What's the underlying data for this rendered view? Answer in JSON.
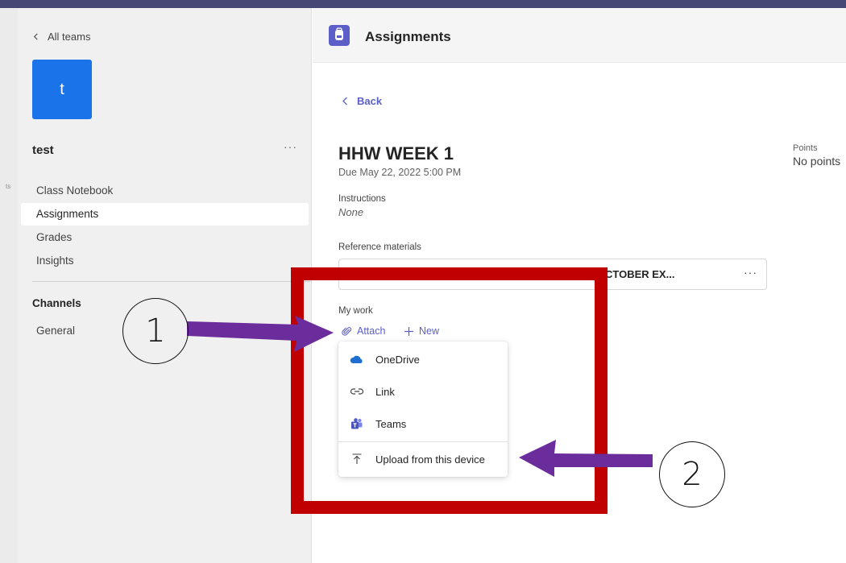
{
  "sidebar": {
    "all_teams": "All teams",
    "team_avatar_letter": "t",
    "team_name": "test",
    "more": "···",
    "nav": [
      "Class Notebook",
      "Assignments",
      "Grades",
      "Insights"
    ],
    "channels_title": "Channels",
    "channels": [
      "General"
    ],
    "left_strip_label": "ts"
  },
  "header": {
    "title": "Assignments",
    "icon": "assignments-backpack-icon"
  },
  "assignment": {
    "back": "Back",
    "title": "HHW WEEK 1",
    "due": "Due May 22, 2022 5:00 PM",
    "points_label": "Points",
    "points_value": "No points",
    "instructions_label": "Instructions",
    "instructions_value": "None",
    "reference_label": "Reference materials",
    "reference_file": "CTOBER EX...",
    "reference_more": "···",
    "my_work_label": "My work",
    "attach": "Attach",
    "new": "New"
  },
  "attach_menu": {
    "items": [
      {
        "label": "OneDrive",
        "icon": "onedrive-cloud-icon"
      },
      {
        "label": "Link",
        "icon": "link-icon"
      },
      {
        "label": "Teams",
        "icon": "teams-icon"
      },
      {
        "label": "Upload from this device",
        "icon": "upload-icon"
      }
    ]
  },
  "annotations": {
    "callout_1": "1",
    "callout_2": "2"
  },
  "colors": {
    "accent": "#5b5fc7",
    "highlight_box": "#c00000",
    "arrow": "#6b2c9c",
    "top_bar": "#464775"
  }
}
